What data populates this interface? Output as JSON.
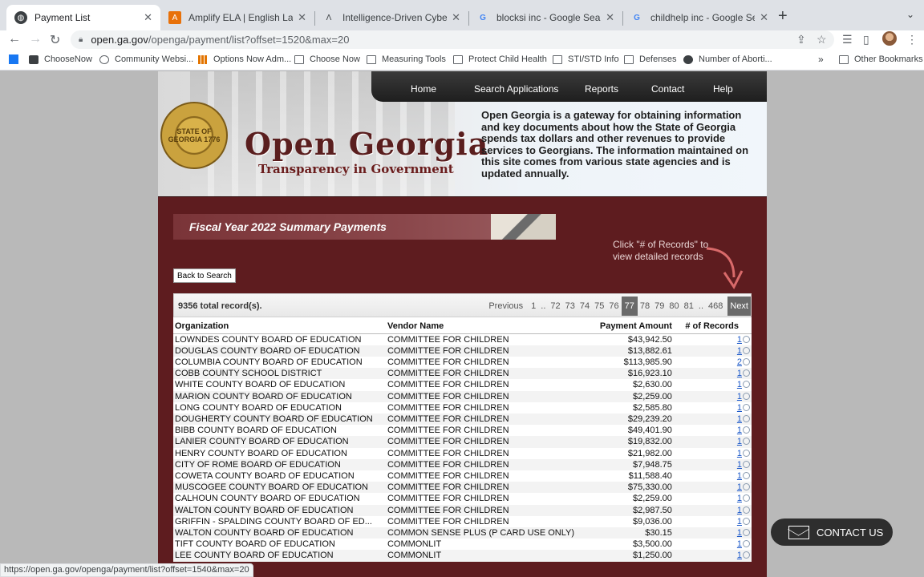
{
  "tabs": [
    {
      "title": "Payment List",
      "active": true,
      "icon": "globe-icon"
    },
    {
      "title": "Amplify ELA | English Language",
      "active": false,
      "icon": "amplify-icon"
    },
    {
      "title": "Intelligence-Driven Cybersecurity",
      "active": false,
      "icon": "lambda-icon"
    },
    {
      "title": "blocksi inc - Google Search",
      "active": false,
      "icon": "google-icon"
    },
    {
      "title": "childhelp inc - Google Search",
      "active": false,
      "icon": "google-icon"
    }
  ],
  "address": {
    "host": "open.ga.gov",
    "path": "/openga/payment/list?offset=1520&max=20"
  },
  "bookmarks": [
    "ChooseNow",
    "Community Websi...",
    "Options Now Adm...",
    "Choose Now",
    "Measuring Tools",
    "Protect Child Health",
    "STI/STD Info",
    "Defenses",
    "Number of Aborti...",
    "Other Bookmarks"
  ],
  "bookmarks_more": "»",
  "site": {
    "nav": [
      "Home",
      "Search Applications",
      "Reports",
      "Contact",
      "Help"
    ],
    "brand_title": "Open Georgia",
    "brand_subtitle": "Transparency in Government",
    "seal_text": "STATE OF GEORGIA 1776",
    "intro": "Open Georgia is a gateway for obtaining information and key documents about how the State of Georgia spends tax dollars and other revenues to provide services to Georgians. The information maintained on this site comes from various state agencies and is updated annually."
  },
  "content": {
    "banner": "Fiscal Year 2022 Summary Payments",
    "hint": "Click \"# of Records\" to view detailed records",
    "back_button": "Back to Search",
    "total": "9356 total record(s).",
    "pager": {
      "previous": "Previous",
      "pages": [
        "1",
        "..",
        "72",
        "73",
        "74",
        "75",
        "76",
        "77",
        "78",
        "79",
        "80",
        "81",
        "..",
        "468"
      ],
      "current": "77",
      "next": "Next"
    },
    "columns": [
      "Organization",
      "Vendor Name",
      "Payment Amount",
      "# of Records"
    ],
    "rows": [
      [
        "LOWNDES COUNTY BOARD OF EDUCATION",
        "COMMITTEE FOR CHILDREN",
        "$43,942.50",
        "1"
      ],
      [
        "DOUGLAS COUNTY BOARD OF EDUCATION",
        "COMMITTEE FOR CHILDREN",
        "$13,882.61",
        "1"
      ],
      [
        "COLUMBIA COUNTY BOARD OF EDUCATION",
        "COMMITTEE FOR CHILDREN",
        "$113,985.90",
        "2"
      ],
      [
        "COBB COUNTY SCHOOL DISTRICT",
        "COMMITTEE FOR CHILDREN",
        "$16,923.10",
        "1"
      ],
      [
        "WHITE COUNTY BOARD OF EDUCATION",
        "COMMITTEE FOR CHILDREN",
        "$2,630.00",
        "1"
      ],
      [
        "MARION COUNTY BOARD OF EDUCATION",
        "COMMITTEE FOR CHILDREN",
        "$2,259.00",
        "1"
      ],
      [
        "LONG COUNTY BOARD OF EDUCATION",
        "COMMITTEE FOR CHILDREN",
        "$2,585.80",
        "1"
      ],
      [
        "DOUGHERTY COUNTY BOARD OF EDUCATION",
        "COMMITTEE FOR CHILDREN",
        "$29,239.20",
        "1"
      ],
      [
        "BIBB COUNTY BOARD OF EDUCATION",
        "COMMITTEE FOR CHILDREN",
        "$49,401.90",
        "1"
      ],
      [
        "LANIER COUNTY BOARD OF EDUCATION",
        "COMMITTEE FOR CHILDREN",
        "$19,832.00",
        "1"
      ],
      [
        "HENRY COUNTY BOARD OF EDUCATION",
        "COMMITTEE FOR CHILDREN",
        "$21,982.00",
        "1"
      ],
      [
        "CITY OF ROME BOARD OF EDUCATION",
        "COMMITTEE FOR CHILDREN",
        "$7,948.75",
        "1"
      ],
      [
        "COWETA COUNTY BOARD OF EDUCATION",
        "COMMITTEE FOR CHILDREN",
        "$11,588.40",
        "1"
      ],
      [
        "MUSCOGEE COUNTY BOARD OF EDUCATION",
        "COMMITTEE FOR CHILDREN",
        "$75,330.00",
        "1"
      ],
      [
        "CALHOUN COUNTY BOARD OF EDUCATION",
        "COMMITTEE FOR CHILDREN",
        "$2,259.00",
        "1"
      ],
      [
        "WALTON COUNTY BOARD OF EDUCATION",
        "COMMITTEE FOR CHILDREN",
        "$2,987.50",
        "1"
      ],
      [
        "GRIFFIN - SPALDING COUNTY BOARD OF ED...",
        "COMMITTEE FOR CHILDREN",
        "$9,036.00",
        "1"
      ],
      [
        "WALTON COUNTY BOARD OF EDUCATION",
        "COMMON SENSE PLUS (P CARD USE ONLY)",
        "$30.15",
        "1"
      ],
      [
        "TIFT COUNTY BOARD OF EDUCATION",
        "COMMONLIT",
        "$3,500.00",
        "1"
      ],
      [
        "LEE COUNTY BOARD OF EDUCATION",
        "COMMONLIT",
        "$1,250.00",
        "1"
      ]
    ]
  },
  "contact_button": "CONTACT US",
  "status_url": "https://open.ga.gov/openga/payment/list?offset=1540&max=20",
  "colors": {
    "content_bg": "#5e1c1f",
    "banner": "#7a3438",
    "link": "#1a57c8",
    "nav": "#2a2a2a"
  }
}
